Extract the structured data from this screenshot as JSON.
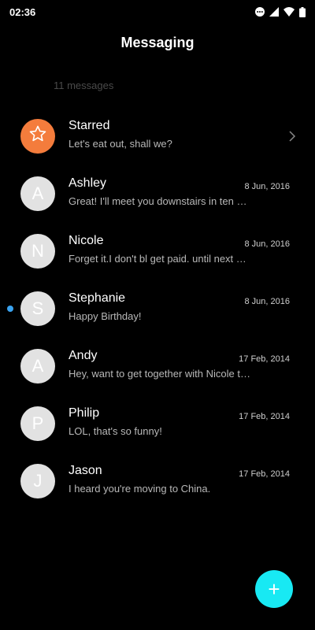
{
  "status": {
    "time": "02:36",
    "icons": [
      "more-circle-icon",
      "signal-icon",
      "wifi-icon",
      "battery-icon"
    ]
  },
  "header": {
    "title": "Messaging"
  },
  "summary": {
    "count_label": "11 messages"
  },
  "colors": {
    "background": "#000000",
    "starred_avatar": "#f47c3c",
    "avatar": "#e2e2e2",
    "unread_dot": "#3aa3f0",
    "fab": "#18e9f3"
  },
  "conversations": [
    {
      "name": "Starred",
      "preview": "Let's eat out, shall we?",
      "avatar": "star-icon",
      "date": ""
    },
    {
      "name": "Ashley",
      "preview": "Great! I'll meet you downstairs in ten minutes.",
      "avatar": "A",
      "date": "8 Jun, 2016"
    },
    {
      "name": "Nicole",
      "preview": "Forget it.I don't bl get paid. until next Friday.",
      "avatar": "N",
      "date": "8 Jun, 2016"
    },
    {
      "name": "Stephanie",
      "preview": "Happy Birthday!",
      "avatar": "S",
      "date": "8 Jun, 2016",
      "unread": true
    },
    {
      "name": "Andy",
      "preview": "Hey, want to get together with Nicole tonight?",
      "avatar": "A",
      "date": "17 Feb, 2014"
    },
    {
      "name": "Philip",
      "preview": "LOL, that's so funny!",
      "avatar": "P",
      "date": "17 Feb, 2014"
    },
    {
      "name": "Jason",
      "preview": "I heard you're moving to China.",
      "avatar": "J",
      "date": "17 Feb, 2014"
    }
  ],
  "fab": {
    "label": "+",
    "icon": "plus-icon"
  }
}
